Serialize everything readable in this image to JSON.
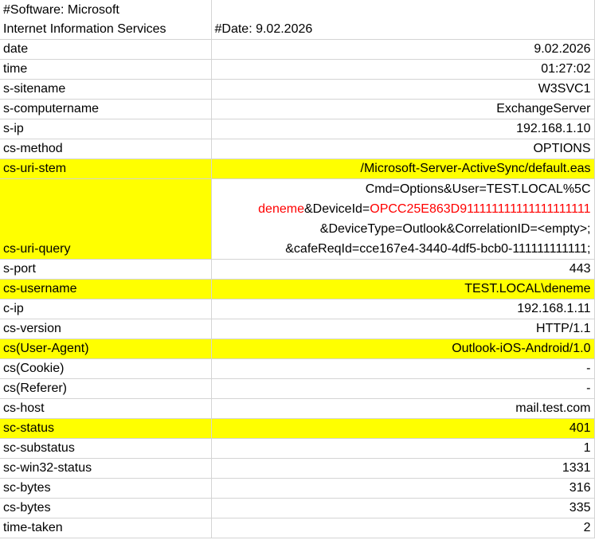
{
  "header": {
    "software_line1": "#Software: Microsoft",
    "software_line2": "Internet Information Services",
    "date": "#Date: 9.02.2026"
  },
  "rows_top": [
    {
      "key": "date",
      "value": "9.02.2026",
      "highlight": false
    },
    {
      "key": "time",
      "value": "01:27:02",
      "highlight": false
    },
    {
      "key": "s-sitename",
      "value": "W3SVC1",
      "highlight": false
    },
    {
      "key": "s-computername",
      "value": "ExchangeServer",
      "highlight": false
    },
    {
      "key": "s-ip",
      "value": "192.168.1.10",
      "highlight": false
    },
    {
      "key": "cs-method",
      "value": "OPTIONS",
      "highlight": false
    },
    {
      "key": "cs-uri-stem",
      "value": "/Microsoft-Server-ActiveSync/default.eas",
      "highlight": true
    }
  ],
  "uri_query": {
    "key": "cs-uri-query",
    "line1": "Cmd=Options&User=TEST.LOCAL%5C",
    "line2_user": "deneme",
    "line2_mid": "&DeviceId=",
    "line2_device": "OPCC25E863D911111111111111111111",
    "line3": "&DeviceType=Outlook&CorrelationID=<empty>;",
    "line4": "&cafeReqId=cce167e4-3440-4df5-bcb0-111111111111;"
  },
  "rows_bottom": [
    {
      "key": "s-port",
      "value": "443",
      "highlight": false
    },
    {
      "key": "cs-username",
      "value": "TEST.LOCAL\\deneme",
      "highlight": true
    },
    {
      "key": "c-ip",
      "value": "192.168.1.11",
      "highlight": false
    },
    {
      "key": "cs-version",
      "value": "HTTP/1.1",
      "highlight": false
    },
    {
      "key": "cs(User-Agent)",
      "value": "Outlook-iOS-Android/1.0",
      "highlight": true
    },
    {
      "key": "cs(Cookie)",
      "value": "-",
      "highlight": false
    },
    {
      "key": "cs(Referer)",
      "value": "-",
      "highlight": false
    },
    {
      "key": "cs-host",
      "value": "mail.test.com",
      "highlight": false
    },
    {
      "key": "sc-status",
      "value": "401",
      "highlight": true
    },
    {
      "key": "sc-substatus",
      "value": "1",
      "highlight": false
    },
    {
      "key": "sc-win32-status",
      "value": "1331",
      "highlight": false
    },
    {
      "key": "sc-bytes",
      "value": "316",
      "highlight": false
    },
    {
      "key": "cs-bytes",
      "value": "335",
      "highlight": false
    },
    {
      "key": "time-taken",
      "value": "2",
      "highlight": false
    }
  ],
  "colors": {
    "highlight": "#ffff00",
    "red_text": "#ff0000",
    "gridline": "#d4d4d4"
  }
}
